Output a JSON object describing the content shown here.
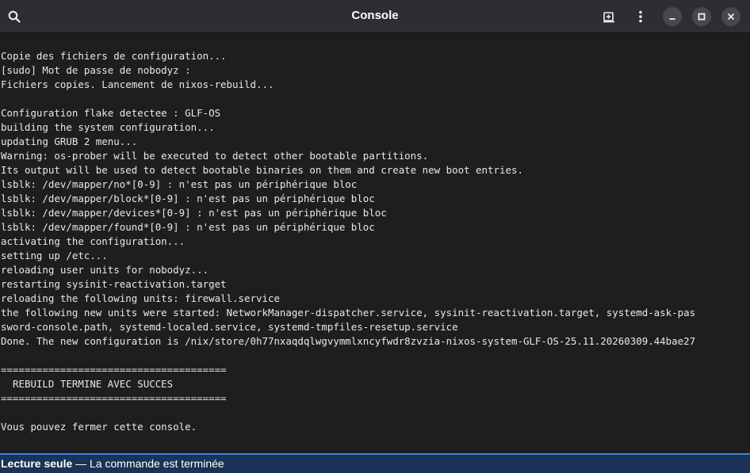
{
  "window": {
    "title": "Console",
    "icons": {
      "search": "search-icon",
      "new_tab": "new-tab-icon",
      "menu": "kebab-menu-icon",
      "minimize": "minimize-icon",
      "maximize": "maximize-icon",
      "close": "close-icon"
    }
  },
  "terminal": {
    "lines": [
      "Copie des fichiers de configuration...",
      "[sudo] Mot de passe de nobodyz :",
      "Fichiers copies. Lancement de nixos-rebuild...",
      "",
      "Configuration flake detectee : GLF-OS",
      "building the system configuration...",
      "updating GRUB 2 menu...",
      "Warning: os-prober will be executed to detect other bootable partitions.",
      "Its output will be used to detect bootable binaries on them and create new boot entries.",
      "lsblk: /dev/mapper/no*[0-9] : n'est pas un périphérique bloc",
      "lsblk: /dev/mapper/block*[0-9] : n'est pas un périphérique bloc",
      "lsblk: /dev/mapper/devices*[0-9] : n'est pas un périphérique bloc",
      "lsblk: /dev/mapper/found*[0-9] : n'est pas un périphérique bloc",
      "activating the configuration...",
      "setting up /etc...",
      "reloading user units for nobodyz...",
      "restarting sysinit-reactivation.target",
      "reloading the following units: firewall.service",
      "the following new units were started: NetworkManager-dispatcher.service, sysinit-reactivation.target, systemd-ask-pas",
      "sword-console.path, systemd-localed.service, systemd-tmpfiles-resetup.service",
      "Done. The new configuration is /nix/store/0h77nxaqdqlwgvymmlxncyfwdr8zvzia-nixos-system-GLF-OS-25.11.20260309.44bae27",
      "",
      "======================================",
      "  REBUILD TERMINE AVEC SUCCES",
      "======================================",
      "",
      "Vous pouvez fermer cette console."
    ]
  },
  "statusbar": {
    "mode": "Lecture seule",
    "message": " — La commande est terminée"
  },
  "colors": {
    "titlebar_bg": "#2e2e32",
    "terminal_bg": "#1e1e20",
    "terminal_fg": "#e8e8e8",
    "statusbar_bg": "#1a3356",
    "statusbar_border": "#3584e4"
  }
}
